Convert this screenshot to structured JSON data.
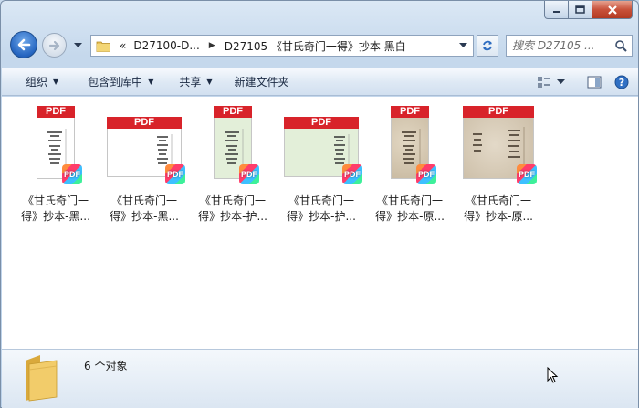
{
  "window": {
    "caption_buttons": [
      "minimize-icon",
      "maximize-icon",
      "close-icon"
    ]
  },
  "navigation": {
    "breadcrumbs": [
      "D27100-D...",
      "D27105 《甘氏奇门一得》抄本 黑白"
    ],
    "overflow_marker": "«",
    "search_placeholder": "搜索 D27105 ..."
  },
  "toolbar": {
    "organize": "组织",
    "include_in_library": "包含到库中",
    "share": "共享",
    "new_folder": "新建文件夹",
    "right_icons": [
      "view-options-icon",
      "preview-pane-icon",
      "help-icon"
    ]
  },
  "files": [
    {
      "name": "《甘氏奇门一得》抄本-黑...",
      "line1": "《甘氏奇门一",
      "line2": "得》抄本-黑...",
      "thumb_style": "tall-white",
      "badge": "PDF"
    },
    {
      "name": "《甘氏奇门一得》抄本-黑...",
      "line1": "《甘氏奇门一",
      "line2": "得》抄本-黑...",
      "thumb_style": "wide-white",
      "badge": "PDF"
    },
    {
      "name": "《甘氏奇门一得》抄本-护...",
      "line1": "《甘氏奇门一",
      "line2": "得》抄本-护...",
      "thumb_style": "tall-green",
      "badge": "PDF"
    },
    {
      "name": "《甘氏奇门一得》抄本-护...",
      "line1": "《甘氏奇门一",
      "line2": "得》抄本-护...",
      "thumb_style": "wide-green",
      "badge": "PDF"
    },
    {
      "name": "《甘氏奇门一得》抄本-原...",
      "line1": "《甘氏奇门一",
      "line2": "得》抄本-原...",
      "thumb_style": "tall-aged",
      "badge": "PDF"
    },
    {
      "name": "《甘氏奇门一得》抄本-原...",
      "line1": "《甘氏奇门一",
      "line2": "得》抄本-原...",
      "thumb_style": "wide-aged",
      "badge": "PDF"
    }
  ],
  "thumb_header": "PDF",
  "status": {
    "item_count": "6 个对象"
  },
  "colors": {
    "pdf_red": "#d8232a",
    "page_green": "#e3efd9",
    "page_aged": "#d9cdb9"
  }
}
